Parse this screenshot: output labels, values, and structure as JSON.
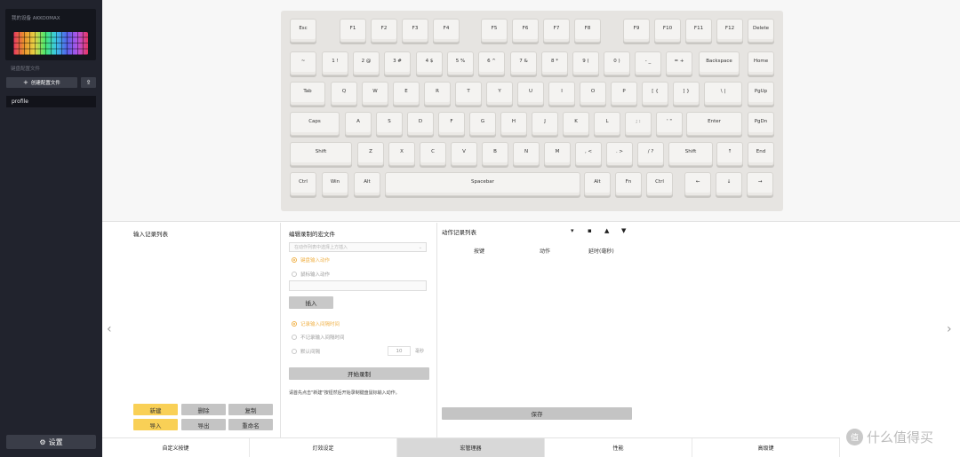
{
  "sidebar": {
    "device_name": "我的设备 AKKO0MAX",
    "profile_section_label": "键盘配置文件",
    "create_profile_label": "创建配置文件",
    "import_icon": "upload-icon",
    "profiles": [
      "profile"
    ],
    "settings_label": "设置",
    "settings_icon": "gear-icon"
  },
  "keyboard": {
    "rows": [
      [
        "Esc",
        "F1",
        "F2",
        "F3",
        "F4",
        "F5",
        "F6",
        "F7",
        "F8",
        "F9",
        "F10",
        "F11",
        "F12",
        "Delete"
      ],
      [
        "~",
        "1 !",
        "2 @",
        "3 #",
        "4 $",
        "5 %",
        "6 ^",
        "7 &",
        "8 *",
        "9 (",
        "0 )",
        "- _",
        "= +",
        "Backspace",
        "Home"
      ],
      [
        "Tab",
        "Q",
        "W",
        "E",
        "R",
        "T",
        "Y",
        "U",
        "I",
        "O",
        "P",
        "[ {",
        "] }",
        "\\ |",
        "PgUp"
      ],
      [
        "Caps",
        "A",
        "S",
        "D",
        "F",
        "G",
        "H",
        "J",
        "K",
        "L",
        ";  :",
        "'  \"",
        "Enter",
        "PgDn"
      ],
      [
        "Shift",
        "Z",
        "X",
        "C",
        "V",
        "B",
        "N",
        "M",
        ", <",
        ". >",
        "/ ?",
        "Shift",
        "↑",
        "End"
      ],
      [
        "Ctrl",
        "Win",
        "Alt",
        "Spacebar",
        "Alt",
        "Fn",
        "Ctrl",
        "←",
        "↓",
        "→"
      ]
    ]
  },
  "macro_list": {
    "title": "输入记录列表",
    "buttons": {
      "new": "新建",
      "delete": "删除",
      "copy": "复制",
      "import": "导入",
      "export": "导出",
      "rename": "重命名"
    }
  },
  "editor": {
    "title": "编辑录制的宏文件",
    "select_placeholder": "在动作列表中选择上方插入",
    "insert_mode_options": [
      "键盘输入动作",
      "鼠标输入动作"
    ],
    "insert_mode_selected": 0,
    "insert_label": "插入",
    "delay_options": [
      "记录输入间隔时间",
      "不记录输入间隔时间",
      "默认间隔"
    ],
    "delay_selected": 0,
    "default_interval_value": "10",
    "default_interval_unit": "毫秒",
    "record_label": "开始录制",
    "hint": "请首先点击\"新建\"按钮然后开始录制键盘鼠标输入动作。"
  },
  "action_list": {
    "title": "动作记录列表",
    "tool_icons": [
      "pin-icon",
      "trash-icon",
      "move-up-icon",
      "move-down-icon"
    ],
    "columns": [
      "按键",
      "动作",
      "延时(毫秒)"
    ],
    "save_label": "保存"
  },
  "nav": {
    "prev_icon": "chevron-left-icon",
    "next_icon": "chevron-right-icon"
  },
  "tabs": {
    "items": [
      "自定义按键",
      "灯效设定",
      "宏管理器",
      "性能",
      "高级键"
    ],
    "active": 2
  },
  "watermark": "什么值得买",
  "colors": {
    "accent": "#f9d056",
    "sidebar": "#21232d",
    "selected_radio": "#f0b24a"
  }
}
